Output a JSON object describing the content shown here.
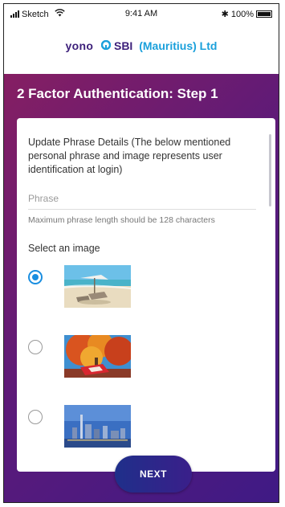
{
  "status_bar": {
    "carrier": "Sketch",
    "time": "9:41 AM",
    "bluetooth": "✱",
    "battery": "100%"
  },
  "brand": {
    "yono": "yono",
    "sbi": "SBI",
    "region": "(Mauritius) Ltd"
  },
  "header": {
    "title": "2 Factor Authentication: Step 1"
  },
  "form": {
    "description": "Update Phrase Details (The below mentioned personal phrase and image represents user identification at login)",
    "phrase_placeholder": "Phrase",
    "phrase_hint": "Maximum phrase length should be 128 characters",
    "select_image_label": "Select an image",
    "images": [
      {
        "name": "beach-image",
        "selected": true
      },
      {
        "name": "autumn-tree-image",
        "selected": false
      },
      {
        "name": "city-skyline-image",
        "selected": false
      }
    ]
  },
  "actions": {
    "next_label": "NEXT"
  },
  "colors": {
    "brand_purple": "#3c1f7a",
    "brand_blue": "#1aa0db",
    "radio_selected": "#1a8ee0",
    "header_gradient_start": "#8e1f5e",
    "header_gradient_end": "#3f1a85"
  }
}
